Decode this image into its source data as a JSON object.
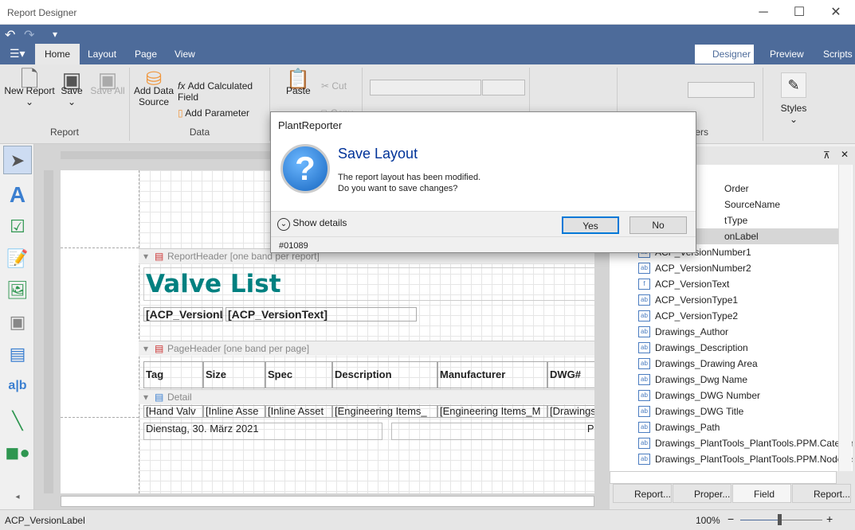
{
  "window": {
    "title": "Report Designer",
    "minimize": "─",
    "maximize": "☐",
    "close": "✕"
  },
  "quick_access": {
    "undo": "↶",
    "redo": "↷",
    "customize": "▾"
  },
  "ribbon": {
    "tabs": [
      {
        "label": "Home",
        "active": true
      },
      {
        "label": "Layout"
      },
      {
        "label": "Page"
      },
      {
        "label": "View"
      }
    ],
    "views": [
      {
        "label": "Designer",
        "active": true
      },
      {
        "label": "Preview"
      },
      {
        "label": "Scripts"
      }
    ],
    "groups": {
      "report": "Report",
      "data": "Data",
      "styles_group": "ers"
    },
    "buttons": {
      "new_report": "New Report",
      "save": "Save",
      "save_all": "Save All",
      "add_data_source": "Add Data Source",
      "add_calculated_field": "Add Calculated Field",
      "add_parameter": "Add Parameter",
      "paste": "Paste",
      "cut": "Cut",
      "copy": "Copy",
      "styles": "Styles"
    }
  },
  "dialog": {
    "caption": "PlantReporter",
    "heading": "Save Layout",
    "message1": "The report layout has been modified.",
    "message2": "Do you want to save changes?",
    "show_details": "Show details",
    "yes": "Yes",
    "no": "No",
    "code": "#01089"
  },
  "report": {
    "report_header": "ReportHeader [one band per report]",
    "title": "Valve List",
    "version_label": "[ACP_VersionL",
    "version_text": "[ACP_VersionText]",
    "page_header": "PageHeader [one band per page]",
    "columns": [
      "Tag",
      "Size",
      "Spec",
      "Description",
      "Manufacturer",
      "DWG#"
    ],
    "detail": "Detail",
    "detail_cells": [
      "[Hand Valv",
      "[Inline Asse",
      "[Inline Asset",
      "[Engineering Items_",
      "[Engineering Items_M",
      "[Drawings"
    ],
    "footer_date": "Dienstag, 30. März 2021",
    "footer_page": "Pag"
  },
  "field_list": {
    "items": [
      {
        "label": "Order",
        "icon": "ab"
      },
      {
        "label": "SourceName",
        "icon": "ab"
      },
      {
        "label": "tType",
        "icon": "ab"
      },
      {
        "label": "onLabel",
        "icon": "ab",
        "selected": true
      },
      {
        "label": "ACP_VersionNumber1",
        "icon": "ab"
      },
      {
        "label": "ACP_VersionNumber2",
        "icon": "ab"
      },
      {
        "label": "ACP_VersionText",
        "icon": "f"
      },
      {
        "label": "ACP_VersionType1",
        "icon": "ab"
      },
      {
        "label": "ACP_VersionType2",
        "icon": "ab"
      },
      {
        "label": "Drawings_Author",
        "icon": "ab"
      },
      {
        "label": "Drawings_Description",
        "icon": "ab"
      },
      {
        "label": "Drawings_Drawing Area",
        "icon": "ab"
      },
      {
        "label": "Drawings_Dwg Name",
        "icon": "ab"
      },
      {
        "label": "Drawings_DWG Number",
        "icon": "ab"
      },
      {
        "label": "Drawings_DWG Title",
        "icon": "ab"
      },
      {
        "label": "Drawings_Path",
        "icon": "ab"
      },
      {
        "label": "Drawings_PlantTools_PlantTools.PPM.Category",
        "icon": "ab"
      },
      {
        "label": "Drawings_PlantTools_PlantTools.PPM.NodeDispl",
        "icon": "ab"
      }
    ],
    "tabs": [
      "Report...",
      "Proper...",
      "Field List",
      "Report..."
    ]
  },
  "status": {
    "selection": "ACP_VersionLabel",
    "zoom": "100%",
    "zoom_level": 100
  },
  "colors": {
    "ribbon_blue": "#4d6b9a",
    "title_teal": "#008080",
    "dialog_heading": "#003399"
  }
}
